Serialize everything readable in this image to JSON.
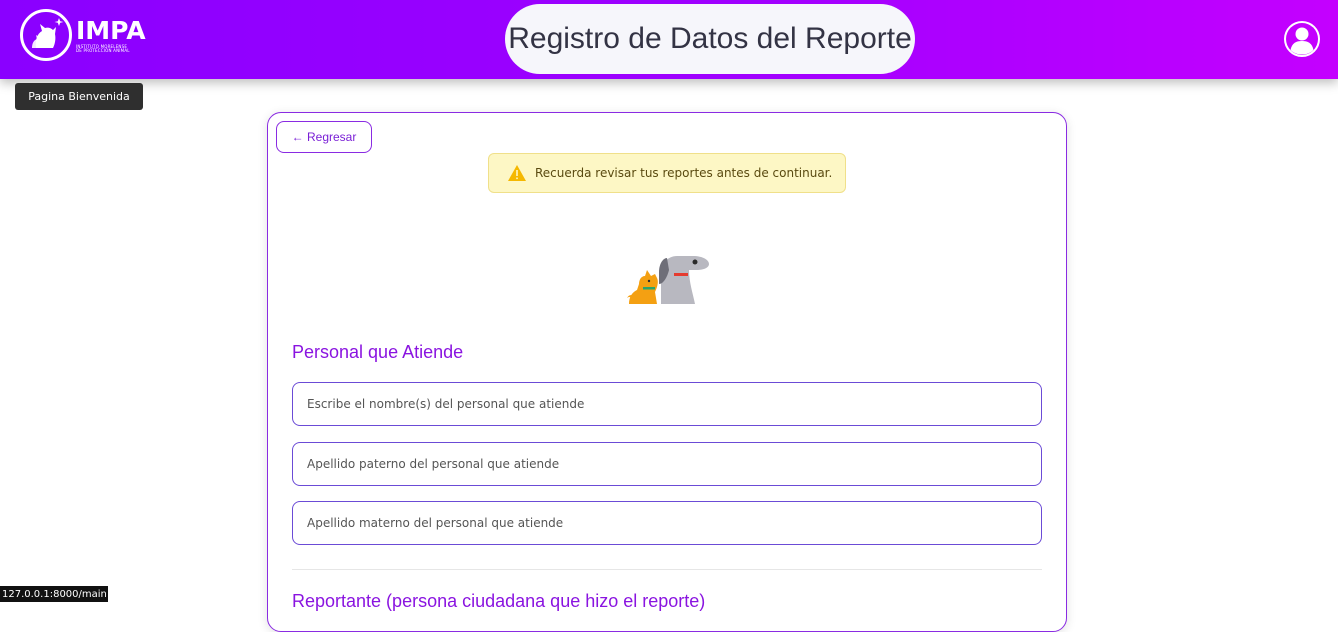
{
  "header": {
    "logo_title": "IMPA",
    "logo_subtitle_line1": "INSTITUTO MORELENSE",
    "logo_subtitle_line2": "DE PROTECCIÓN ANIMAL",
    "page_title": "Registro de Datos del Reporte",
    "user_icon": "user-icon"
  },
  "tooltip": {
    "text": "Pagina Bienvenida"
  },
  "card": {
    "back_label": "← Regresar",
    "alert_text": "Recuerda revisar tus reportes antes de continuar.",
    "alert_icon": "warning-icon",
    "illustration": "dog-cat-illustration"
  },
  "sections": {
    "personal": {
      "title": "Personal que Atiende",
      "fields": [
        {
          "placeholder": "Escribe el nombre(s) del personal que atiende",
          "value": ""
        },
        {
          "placeholder": "Apellido paterno del personal que atiende",
          "value": ""
        },
        {
          "placeholder": "Apellido materno del personal que atiende",
          "value": ""
        }
      ]
    },
    "reportante": {
      "title": "Reportante (persona ciudadana que hizo el reporte)"
    }
  },
  "status_bar": {
    "url": "127.0.0.1:8000/main"
  },
  "colors": {
    "header_start": "#8a00ff",
    "header_end": "#c400ff",
    "accent": "#8a14e0",
    "alert_bg": "#fdf7c5",
    "warning": "#f5b800"
  }
}
